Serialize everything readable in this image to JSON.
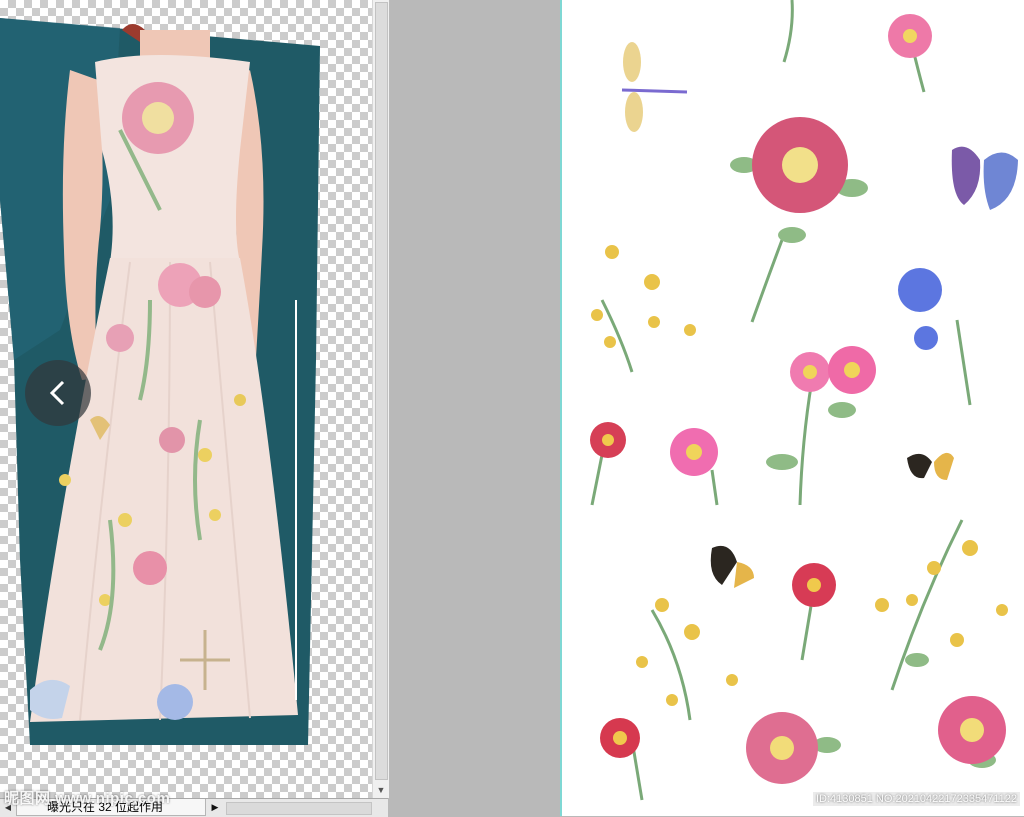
{
  "left_document": {
    "nav": {
      "prev_icon": "chevron-left-icon"
    },
    "status_bar": {
      "text": "曝光只在 32 位起作用",
      "menu_icon": "triangle-right-icon",
      "scroll_left_icon": "triangle-left-icon"
    },
    "scrollbar": {
      "arrow_icon": "triangle-down-icon"
    }
  },
  "right_document": {
    "pattern": "floral-print"
  },
  "watermarks": {
    "left": "昵图网 www.nipic.com",
    "right": "ID:4130851 NO:20210422172335471122"
  },
  "colors": {
    "canvas_gray": "#b9b9b9",
    "backdrop_teal": "#1f5a66",
    "dress": "#f3e4df",
    "right_border": "#7fd8d4"
  }
}
